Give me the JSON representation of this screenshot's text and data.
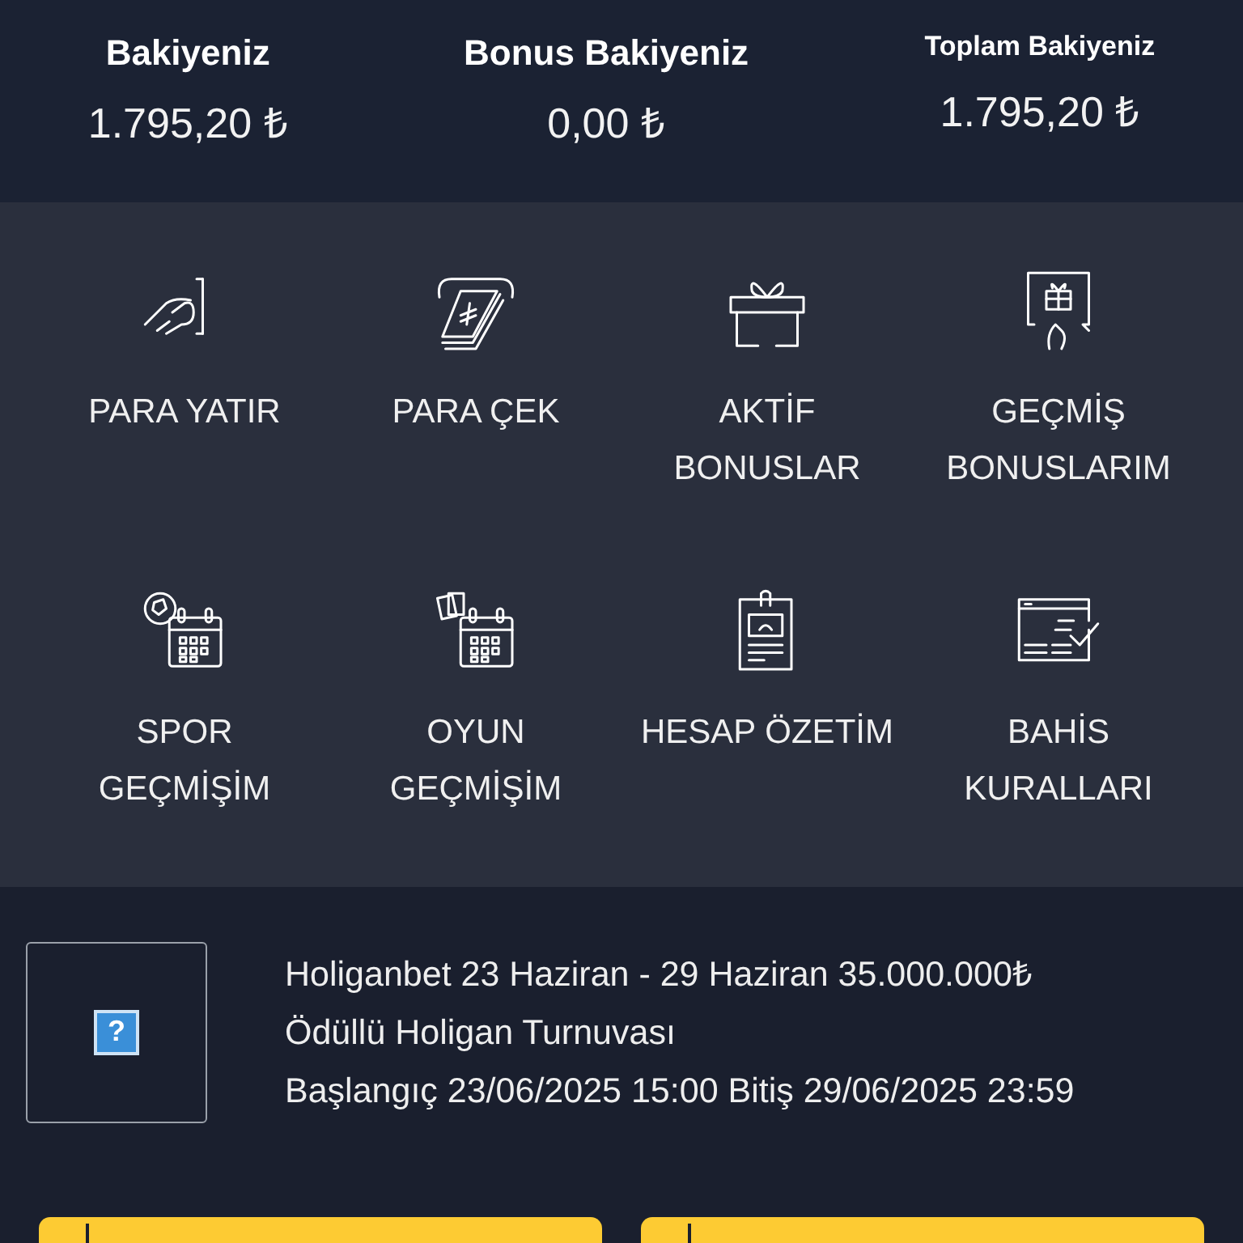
{
  "balances": [
    {
      "label": "Bakiyeniz",
      "value": "1.795,20 ₺",
      "kind": "main"
    },
    {
      "label": "Bonus Bakiyeniz",
      "value": "0,00 ₺",
      "kind": "main"
    },
    {
      "label": "Toplam Bakiyeniz",
      "value": "1.795,20 ₺",
      "kind": "small"
    }
  ],
  "menu": [
    {
      "kind": "deposit",
      "lines": [
        "PARA YATIR"
      ]
    },
    {
      "kind": "withdraw",
      "lines": [
        "PARA ÇEK"
      ]
    },
    {
      "kind": "gift",
      "lines": [
        "AKTİF",
        "BONUSLAR"
      ]
    },
    {
      "kind": "giftcard",
      "lines": [
        "GEÇMİŞ",
        "BONUSLARIM"
      ]
    },
    {
      "kind": "sport",
      "lines": [
        "SPOR",
        "GEÇMİŞİM"
      ]
    },
    {
      "kind": "game",
      "lines": [
        "OYUN",
        "GEÇMİŞİM"
      ]
    },
    {
      "kind": "statement",
      "lines": [
        "HESAP ÖZETİM"
      ]
    },
    {
      "kind": "rules",
      "lines": [
        "BAHİS",
        "KURALLARI"
      ]
    }
  ],
  "promo": {
    "image_icon": "?",
    "lines": [
      "Holiganbet 23 Haziran - 29 Haziran 35.000.000₺",
      "Ödüllü Holigan Turnuvası",
      "Başlangıç 23/06/2025 15:00 Bitiş 29/06/2025 23:59"
    ]
  },
  "buttons": [
    {
      "kind": "action"
    },
    {
      "kind": "action"
    }
  ]
}
